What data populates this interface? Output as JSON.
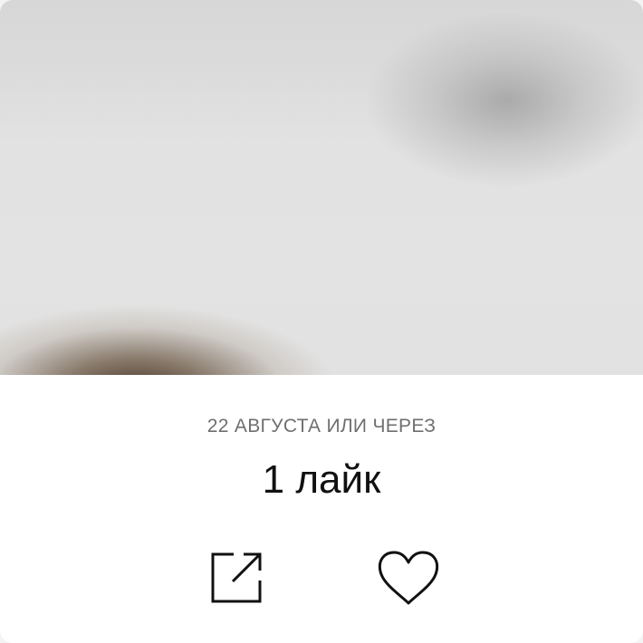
{
  "post": {
    "date_text": "22 АВГУСТА ИЛИ ЧЕРЕЗ",
    "likes_text": "1 лайк"
  },
  "actions": {
    "share_icon": "share-icon",
    "like_icon": "heart-icon"
  },
  "colors": {
    "background": "#ffffff",
    "meta_text": "#6f6f6f",
    "primary_text": "#111111",
    "icon_stroke": "#111111"
  }
}
